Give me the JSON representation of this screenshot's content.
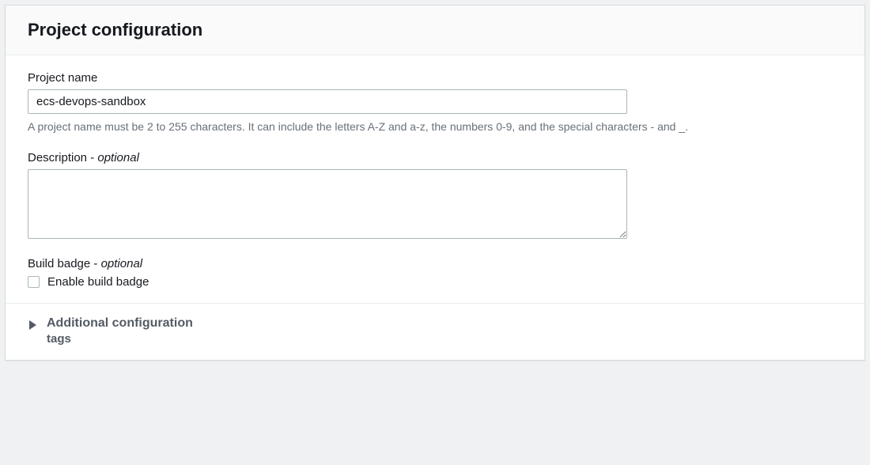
{
  "panelTitle": "Project configuration",
  "projectName": {
    "label": "Project name",
    "value": "ecs-devops-sandbox",
    "help": "A project name must be 2 to 255 characters. It can include the letters A-Z and a-z, the numbers 0-9, and the special characters - and _."
  },
  "description": {
    "label": "Description",
    "suffix": " - ",
    "optional": "optional",
    "value": ""
  },
  "buildBadge": {
    "label": "Build badge",
    "suffix": " - ",
    "optional": "optional",
    "checkboxLabel": "Enable build badge",
    "checked": false
  },
  "expander": {
    "title": "Additional configuration",
    "subtitle": "tags"
  }
}
